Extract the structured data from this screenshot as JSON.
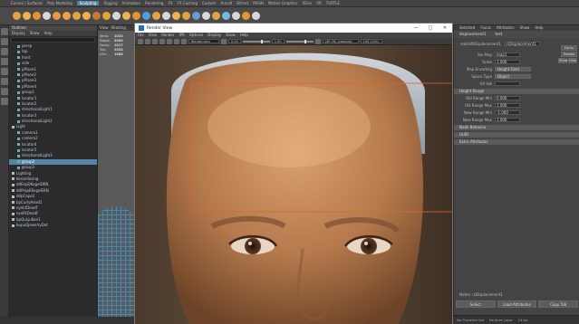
{
  "shelf": {
    "tabs": [
      "Curves / Surfaces",
      "Poly Modeling",
      "Sculpting",
      "Rigging",
      "Animation",
      "Rendering",
      "FX",
      "FX Caching",
      "Custom",
      "Arnold",
      "Bifrost",
      "MASH",
      "Motion Graphics",
      "XGen",
      "VR",
      "TURTLE"
    ],
    "active_tab": "Sculpting",
    "icon_colors": [
      "#e8a23a",
      "#f0b04a",
      "#e8922a",
      "#d8d8d8",
      "#e89a3a",
      "#f0a040",
      "#e8a23a",
      "#f0b04a",
      "#c87a2a",
      "#e8a23a",
      "#d8d8d8",
      "#f0b04a",
      "#e8922a",
      "#4aa0e8",
      "#e8a23a",
      "#d8d8d8",
      "#f0b04a",
      "#e8a23a",
      "#6a9ad8",
      "#d8d8d8",
      "#e8a23a",
      "#6ac0e0",
      "#d8d8d8",
      "#e8922a",
      "#d8d8d8"
    ]
  },
  "outliner": {
    "title": "Outliner",
    "menu": [
      "Display",
      "Show",
      "Help"
    ],
    "items": [
      {
        "label": "persp",
        "type": "item"
      },
      {
        "label": "top",
        "type": "item"
      },
      {
        "label": "front",
        "type": "item"
      },
      {
        "label": "side",
        "type": "item"
      },
      {
        "label": "pPlane1",
        "type": "item"
      },
      {
        "label": "pPlane2",
        "type": "item"
      },
      {
        "label": "pPlane3",
        "type": "item"
      },
      {
        "label": "pPlane4",
        "type": "item"
      },
      {
        "label": "group1",
        "type": "item"
      },
      {
        "label": "locator1",
        "type": "item"
      },
      {
        "label": "locator2",
        "type": "item"
      },
      {
        "label": "directionalLight1",
        "type": "item"
      },
      {
        "label": "locator3",
        "type": "item"
      },
      {
        "label": "directionalLight2",
        "type": "item"
      },
      {
        "label": "Light",
        "type": "grp"
      },
      {
        "label": "camera1",
        "type": "item"
      },
      {
        "label": "camera2",
        "type": "item"
      },
      {
        "label": "locator4",
        "type": "item"
      },
      {
        "label": "locator5",
        "type": "item"
      },
      {
        "label": "directionalLight3",
        "type": "item"
      },
      {
        "label": "group2",
        "type": "sel"
      },
      {
        "label": "group3",
        "type": "item"
      },
      {
        "label": "Lighting",
        "type": "grp"
      },
      {
        "label": "Kessellosing",
        "type": "grp"
      },
      {
        "label": "ddExpDKugelDKN",
        "type": "grp"
      },
      {
        "label": "ddPropEKugelEKN",
        "type": "grp"
      },
      {
        "label": "ddpCape2",
        "type": "grp"
      },
      {
        "label": "bpCurlyHead1",
        "type": "grp"
      },
      {
        "label": "eyeLtDeadF",
        "type": "grp"
      },
      {
        "label": "eyeRtDeadF",
        "type": "grp"
      },
      {
        "label": "bpQuLjuKoe1",
        "type": "grp"
      },
      {
        "label": "bupuQjewelryDot",
        "type": "grp"
      }
    ]
  },
  "viewport": {
    "menu": [
      "View",
      "Shading"
    ],
    "hud": [
      {
        "k": "Verts:",
        "v": "1024"
      },
      {
        "k": "Edges:",
        "v": "2040"
      },
      {
        "k": "Faces:",
        "v": "1017"
      },
      {
        "k": "Tris:",
        "v": "2034"
      },
      {
        "k": "UVs:",
        "v": "1088"
      }
    ]
  },
  "render_view": {
    "title": "Render View",
    "menu": [
      "File",
      "View",
      "Render",
      "IPR",
      "Options",
      "Display",
      "Show",
      "Help"
    ],
    "camera": "Render.cam",
    "zoom": "1.00",
    "exposure": "0.00",
    "gamma": "1.00",
    "size_label": "(4K 2K) (camera)",
    "frame_label": "100 (100)",
    "win_buttons": [
      "—",
      "□",
      "✕"
    ]
  },
  "attribute_editor": {
    "tabs": [
      "Selected",
      "Focus",
      "Attributes",
      "Show",
      "Help"
    ],
    "node_tabs": [
      "displacement1",
      "test"
    ],
    "node_name_label": "redshiftDisplacement1",
    "node_name_value": "rsDisplacement1",
    "side_buttons": [
      "Focus",
      "Presets",
      "Show",
      "Hide"
    ],
    "rows": [
      {
        "label": "Tex Map",
        "value": "map1",
        "kind": "val"
      },
      {
        "label": "Scale",
        "value": "1.000",
        "kind": "val"
      },
      {
        "label": "Map Encoding",
        "value": "Height Field",
        "kind": "dd"
      },
      {
        "label": "Space Type",
        "value": "Object",
        "kind": "dd"
      },
      {
        "label": "UV Set",
        "value": "",
        "kind": "val"
      }
    ],
    "section_remap": "Height Range",
    "remap_rows": [
      {
        "label": "Old Range Min",
        "value": "0.000"
      },
      {
        "label": "Old Range Max",
        "value": "1.000"
      },
      {
        "label": "New Range Min",
        "value": "-1.000"
      },
      {
        "label": "New Range Max",
        "value": "1.000"
      }
    ],
    "sections": [
      "Node Behavior",
      "UUID",
      "Extra Attributes"
    ],
    "notes_label": "Notes: rsDisplacement1",
    "bottom_buttons": [
      "Select",
      "Load Attributes",
      "Copy Tab"
    ]
  },
  "status": {
    "character_set": "No Character Set",
    "anim_layer": "No Anim Layer",
    "fps": "24 fps"
  }
}
